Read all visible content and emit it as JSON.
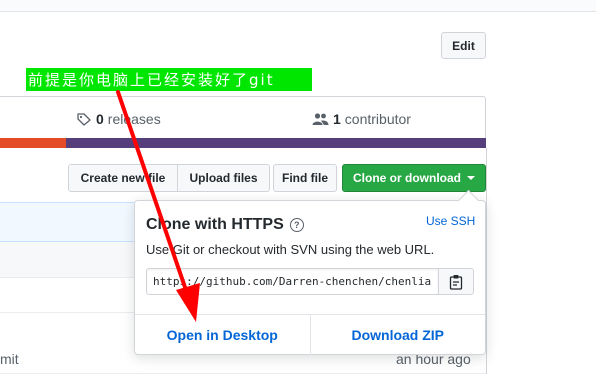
{
  "header": {
    "edit_label": "Edit"
  },
  "annotation": {
    "text": "前提是你电脑上已经安装好了git",
    "color": "#00e600"
  },
  "stats": {
    "releases_count": "0",
    "releases_label": "releases",
    "releases_icon": "tag-icon",
    "contributors_count": "1",
    "contributors_label": "contributor",
    "contributors_icon": "people-icon"
  },
  "language_bar": {
    "colors": [
      "#e34c26",
      "#563d7c"
    ]
  },
  "file_actions": {
    "create_label": "Create new file",
    "upload_label": "Upload files",
    "find_label": "Find file",
    "clone_label": "Clone or download",
    "clone_color": "#28a745"
  },
  "clone_popup": {
    "title": "Clone with HTTPS",
    "use_ssh": "Use SSH",
    "description": "Use Git or checkout with SVN using the web URL.",
    "url_value": "https://github.com/Darren-chenchen/chenlia",
    "open_desktop": "Open in Desktop",
    "download_zip": "Download ZIP",
    "link_color": "#0366d6"
  },
  "file_list": {
    "row_text": "mit",
    "row_time": "an hour ago"
  }
}
